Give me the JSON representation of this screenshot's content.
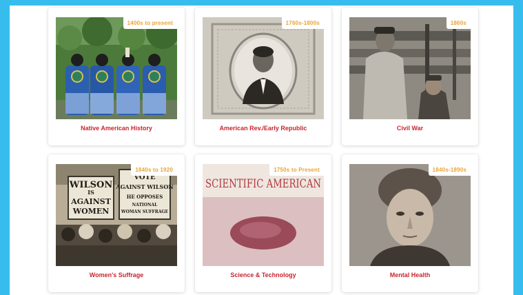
{
  "colors": {
    "frame": "#36bdee",
    "badge_text": "#e8a335",
    "label_text": "#c9252f"
  },
  "cards": [
    {
      "era": "1400s to present",
      "title": "Native American History"
    },
    {
      "era": "1760s-1800s",
      "title": "American Rev./Early Republic"
    },
    {
      "era": "1860s",
      "title": "Civil War"
    },
    {
      "era": "1840s to 1920",
      "title": "Women's Suffrage",
      "signs": [
        "WILSON",
        "IS",
        "AGAINST",
        "WOMEN",
        "VOTE",
        "AGAINST WILSON",
        "HE OPPOSES",
        "NATIONAL",
        "WOMAN SUFFRAGE"
      ]
    },
    {
      "era": "1750s to Present",
      "title": "Science & Technology",
      "masthead": "SCIENTIFIC AMERICAN"
    },
    {
      "era": "1840s-1890s",
      "title": "Mental Health"
    }
  ]
}
